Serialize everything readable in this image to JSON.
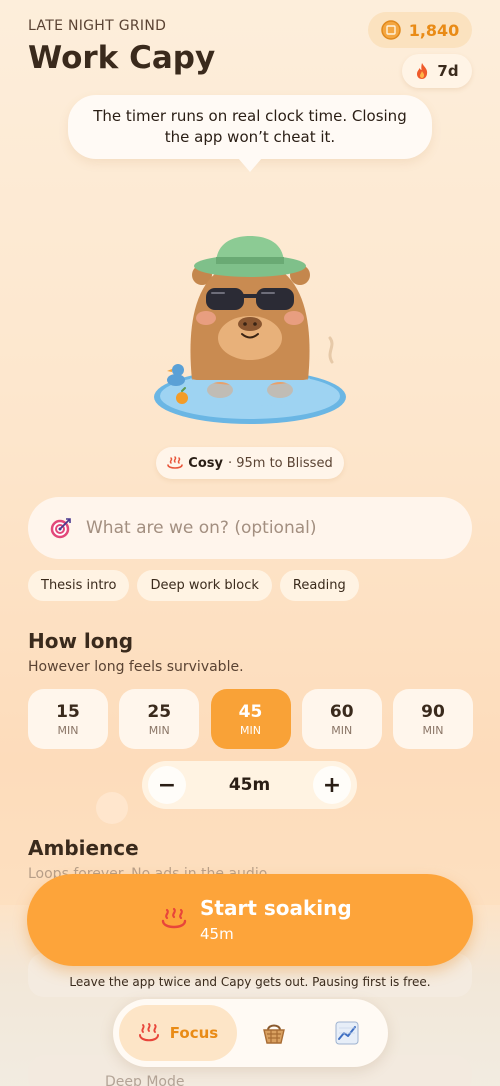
{
  "header": {
    "eyebrow": "LATE NIGHT GRIND",
    "title": "Work Capy",
    "coins": "1,840",
    "streak": "7d"
  },
  "tip": {
    "line1": "The timer runs on real clock time. Closing",
    "line2": "the app won’t cheat it."
  },
  "mood": {
    "label": "Cosy",
    "sub": "· 95m to Blissed"
  },
  "task": {
    "placeholder": "What are we on? (optional)",
    "chips": [
      "Thesis intro",
      "Deep work block",
      "Reading"
    ]
  },
  "duration": {
    "heading": "How long",
    "description": "However long feels survivable.",
    "options": [
      {
        "n": "15",
        "u": "MIN"
      },
      {
        "n": "25",
        "u": "MIN"
      },
      {
        "n": "45",
        "u": "MIN"
      },
      {
        "n": "60",
        "u": "MIN"
      },
      {
        "n": "90",
        "u": "MIN"
      }
    ],
    "selected": "45",
    "stepper_value": "45m",
    "minus": "−",
    "plus": "+"
  },
  "ambience": {
    "heading": "Ambience",
    "description": "Loops forever. No ads in the audio."
  },
  "start": {
    "label": "Start soaking",
    "sub": "45m"
  },
  "warning": "Leave the app twice and Capy gets out. Pausing first is free.",
  "ghost": {
    "text": "Deep Mode"
  },
  "tabs": {
    "focus": "Focus"
  },
  "colors": {
    "accent": "#fda43a",
    "accent_text": "#e98b16",
    "dark_text": "#3a2a1c"
  }
}
